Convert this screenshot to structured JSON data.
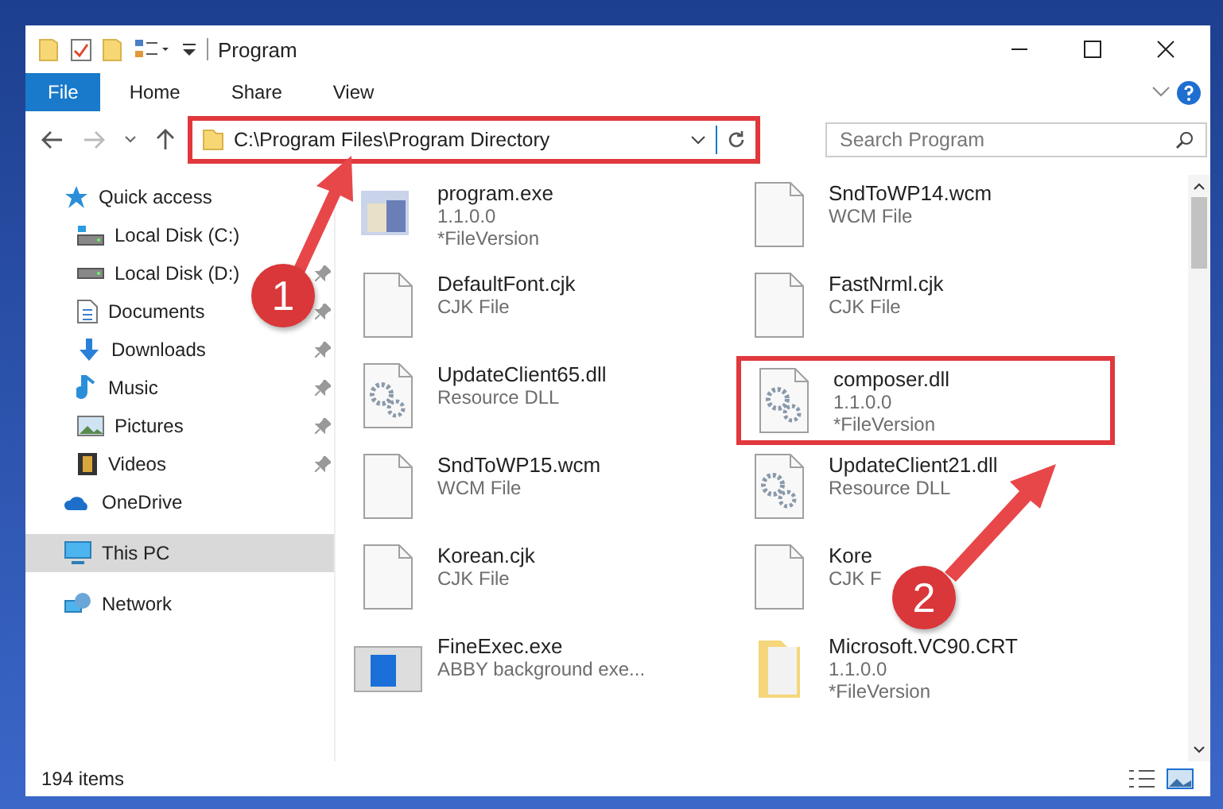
{
  "window": {
    "title": "Program"
  },
  "ribbon_tabs": [
    {
      "label": "File",
      "selected": true
    },
    {
      "label": "Home",
      "selected": false
    },
    {
      "label": "Share",
      "selected": false
    },
    {
      "label": "View",
      "selected": false
    }
  ],
  "address": {
    "value": "C:\\Program Files\\Program Directory",
    "highlighted": true
  },
  "search": {
    "placeholder": "Search Program"
  },
  "sidebar": {
    "items": [
      {
        "label": "Quick access",
        "kind": "star",
        "selected": false,
        "children": [
          {
            "label": "Local Disk (C:)",
            "kind": "drive-c",
            "pinned": false,
            "selected": false
          },
          {
            "label": "Local Disk (D:)",
            "kind": "drive",
            "pinned": true,
            "selected": false
          },
          {
            "label": "Documents",
            "kind": "documents",
            "pinned": true,
            "selected": false
          },
          {
            "label": "Downloads",
            "kind": "downloads",
            "pinned": true,
            "selected": false
          },
          {
            "label": "Music",
            "kind": "music",
            "pinned": true,
            "selected": false
          },
          {
            "label": "Pictures",
            "kind": "pictures",
            "pinned": true,
            "selected": false
          },
          {
            "label": "Videos",
            "kind": "videos",
            "pinned": true,
            "selected": false
          }
        ]
      },
      {
        "label": "OneDrive",
        "kind": "cloud",
        "selected": false
      },
      {
        "label": "This PC",
        "kind": "pc",
        "selected": true
      },
      {
        "label": "Network",
        "kind": "network",
        "selected": false
      }
    ]
  },
  "files": [
    {
      "name": "program.exe",
      "details": [
        "1.1.0.0",
        "*FileVersion"
      ],
      "kind": "exe",
      "highlighted": false
    },
    {
      "name": "SndToWP14.wcm",
      "details": [
        "WCM File"
      ],
      "kind": "doc",
      "highlighted": false
    },
    {
      "name": "DefaultFont.cjk",
      "details": [
        "CJK File"
      ],
      "kind": "doc",
      "highlighted": false
    },
    {
      "name": "FastNrml.cjk",
      "details": [
        "CJK File"
      ],
      "kind": "doc",
      "highlighted": false
    },
    {
      "name": "UpdateClient65.dll",
      "details": [
        "Resource DLL"
      ],
      "kind": "dll",
      "highlighted": false
    },
    {
      "name": "composer.dll",
      "details": [
        "1.1.0.0",
        "*FileVersion"
      ],
      "kind": "dll",
      "highlighted": true
    },
    {
      "name": "SndToWP15.wcm",
      "details": [
        "WCM File"
      ],
      "kind": "doc",
      "highlighted": false
    },
    {
      "name": "UpdateClient21.dll",
      "details": [
        "Resource DLL"
      ],
      "kind": "dll",
      "highlighted": false
    },
    {
      "name": "Korean.cjk",
      "details": [
        "CJK File"
      ],
      "kind": "doc",
      "highlighted": false
    },
    {
      "name": "Kore",
      "details": [
        "CJK F"
      ],
      "kind": "doc",
      "highlighted": false
    },
    {
      "name": "FineExec.exe",
      "details": [
        "ABBY background exe..."
      ],
      "kind": "app",
      "highlighted": false
    },
    {
      "name": "Microsoft.VC90.CRT",
      "details": [
        "1.1.0.0",
        "*FileVersion"
      ],
      "kind": "folder",
      "highlighted": false
    }
  ],
  "status_bar": {
    "count": "194 items"
  },
  "callouts": [
    {
      "label": "1"
    },
    {
      "label": "2"
    }
  ]
}
